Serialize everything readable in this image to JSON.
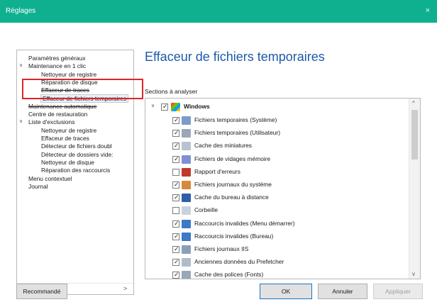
{
  "window": {
    "title": "Réglages",
    "close_glyph": "×"
  },
  "tree": {
    "items": [
      {
        "label": "Paramètres généraux",
        "level": 0,
        "expanded": null,
        "strike": false,
        "selected": false
      },
      {
        "label": "Maintenance en 1 clic",
        "level": 0,
        "expanded": true,
        "strike": false,
        "selected": false
      },
      {
        "label": "Nettoyeur de registre",
        "level": 1,
        "expanded": null,
        "strike": false,
        "selected": false
      },
      {
        "label": "Réparation de disque",
        "level": 1,
        "expanded": null,
        "strike": false,
        "selected": false
      },
      {
        "label": "Effaceur de traces",
        "level": 1,
        "expanded": null,
        "strike": true,
        "selected": false
      },
      {
        "label": "Effaceur de fichiers temporaires",
        "level": 1,
        "expanded": null,
        "strike": false,
        "selected": true
      },
      {
        "label": "Maintenance automatique",
        "level": 0,
        "expanded": null,
        "strike": true,
        "selected": false
      },
      {
        "label": "Centre de restauration",
        "level": 0,
        "expanded": null,
        "strike": false,
        "selected": false
      },
      {
        "label": "Liste d'exclusions",
        "level": 0,
        "expanded": true,
        "strike": false,
        "selected": false
      },
      {
        "label": "Nettoyeur de registre",
        "level": 1,
        "expanded": null,
        "strike": false,
        "selected": false
      },
      {
        "label": "Effaceur de traces",
        "level": 1,
        "expanded": null,
        "strike": false,
        "selected": false
      },
      {
        "label": "Détecteur de fichiers doubl",
        "level": 1,
        "expanded": null,
        "strike": false,
        "selected": false
      },
      {
        "label": "Détecteur de dossiers vide:",
        "level": 1,
        "expanded": null,
        "strike": false,
        "selected": false
      },
      {
        "label": "Nettoyeur de disque",
        "level": 1,
        "expanded": null,
        "strike": false,
        "selected": false
      },
      {
        "label": "Réparation des raccourcis",
        "level": 1,
        "expanded": null,
        "strike": false,
        "selected": false
      },
      {
        "label": "Menu contextuel",
        "level": 0,
        "expanded": null,
        "strike": false,
        "selected": false
      },
      {
        "label": "Journal",
        "level": 0,
        "expanded": null,
        "strike": false,
        "selected": false
      }
    ],
    "scroll_left": "<",
    "scroll_right": ">"
  },
  "panel": {
    "title": "Effaceur de fichiers temporaires",
    "sections_label": "Sections à analyser"
  },
  "list": {
    "group": {
      "label": "Windows",
      "checked": true
    },
    "items": [
      {
        "label": "Fichiers temporaires (Système)",
        "checked": true,
        "icon": "system-temp-icon",
        "color": "#7a9cc9"
      },
      {
        "label": "Fichiers temporaires (Utilisateur)",
        "checked": true,
        "icon": "user-temp-icon",
        "color": "#9aa7b8"
      },
      {
        "label": "Cache des miniatures",
        "checked": true,
        "icon": "thumbnail-cache-icon",
        "color": "#b9c3cf"
      },
      {
        "label": "Fichiers de vidages mémoire",
        "checked": true,
        "icon": "memory-dump-icon",
        "color": "#7f8fd6"
      },
      {
        "label": "Rapport d'erreurs",
        "checked": false,
        "icon": "error-report-icon",
        "color": "#c0392b"
      },
      {
        "label": "Fichiers journaux du système",
        "checked": true,
        "icon": "system-log-icon",
        "color": "#d68a3c"
      },
      {
        "label": "Cache du bureau à distance",
        "checked": true,
        "icon": "remote-desktop-icon",
        "color": "#2e5fa8"
      },
      {
        "label": "Corbeille",
        "checked": false,
        "icon": "recycle-bin-icon",
        "color": "#c9d3dd"
      },
      {
        "label": "Raccourcis invalides (Menu démarrer)",
        "checked": true,
        "icon": "start-menu-shortcut-icon",
        "color": "#3a7ac7"
      },
      {
        "label": "Raccourcis invalides (Bureau)",
        "checked": true,
        "icon": "desktop-shortcut-icon",
        "color": "#3a7ac7"
      },
      {
        "label": "Fichiers journaux IIS",
        "checked": true,
        "icon": "iis-log-icon",
        "color": "#8aa0b8"
      },
      {
        "label": "Anciennes données du Prefetcher",
        "checked": true,
        "icon": "prefetch-icon",
        "color": "#b0bcc9"
      },
      {
        "label": "Cache des polices (Fonts)",
        "checked": true,
        "icon": "font-cache-icon",
        "color": "#9aa7b8"
      }
    ],
    "scroll_up": "^",
    "scroll_down": "v"
  },
  "buttons": {
    "recommended": "Recommandé",
    "ok": "OK",
    "cancel": "Annuler",
    "apply": "Appliquer"
  },
  "colors": {
    "titlebar": "#0fb08f",
    "heading": "#1c5aa8",
    "highlight": "#e0232a"
  }
}
